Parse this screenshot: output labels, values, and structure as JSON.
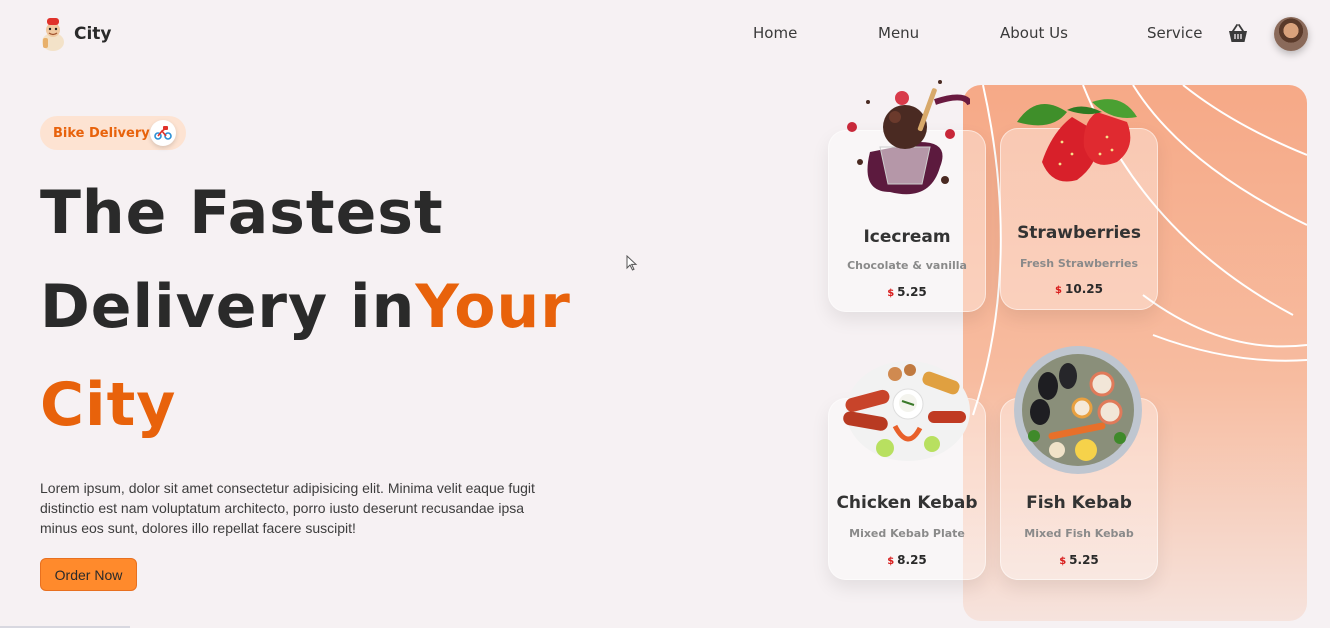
{
  "brand": {
    "name": "City",
    "logo_icon": "chef-logo-icon"
  },
  "nav": {
    "items": [
      "Home",
      "Menu",
      "About Us",
      "Service"
    ],
    "cart_icon": "basket-icon",
    "avatar": "user-avatar"
  },
  "hero": {
    "badge_label": "Bike Delivery",
    "badge_icon": "delivery-bike-icon",
    "line1": "The Fastest",
    "line2_dark": "Delivery in",
    "line2_accent": "Your",
    "line3_accent": "City",
    "description": "Lorem ipsum, dolor sit amet consectetur adipisicing elit. Minima velit eaque fugit distinctio est nam voluptatum architecto, porro iusto deserunt recusandae ipsa minus eos sunt, dolores illo repellat facere suscipit!",
    "cta_label": "Order Now"
  },
  "menu_cards": [
    {
      "title": "Icecream",
      "subtitle": "Chocolate & vanilla",
      "currency": "$",
      "price": "5.25",
      "image": "icecream-image"
    },
    {
      "title": "Strawberries",
      "subtitle": "Fresh Strawberries",
      "currency": "$",
      "price": "10.25",
      "image": "strawberries-image"
    },
    {
      "title": "Chicken Kebab",
      "subtitle": "Mixed Kebab Plate",
      "currency": "$",
      "price": "8.25",
      "image": "chicken-kebab-image"
    },
    {
      "title": "Fish Kebab",
      "subtitle": "Mixed Fish Kebab",
      "currency": "$",
      "price": "5.25",
      "image": "fish-kebab-image"
    }
  ],
  "colors": {
    "accent": "#e8620b",
    "button": "#ff8a2c",
    "panel": "#f6a987",
    "background": "#f6f1f3",
    "price_currency": "#d81c1c"
  }
}
